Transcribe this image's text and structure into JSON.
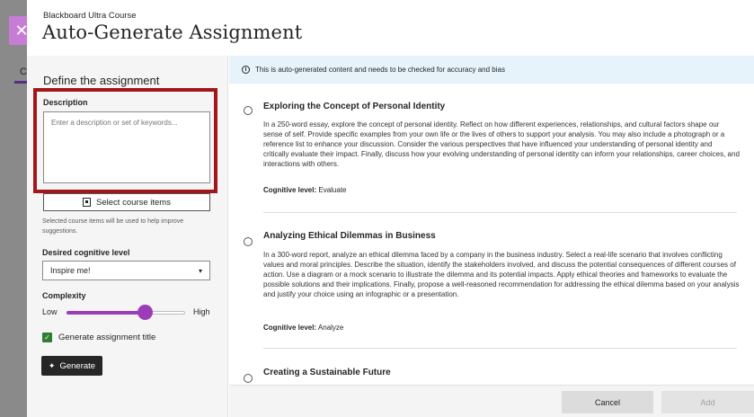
{
  "header": {
    "course_name": "Blackboard Ultra Course",
    "page_title": "Auto-Generate Assignment",
    "close_icon": "close-icon",
    "background_tab_letter": "C"
  },
  "left_panel": {
    "title": "Define the assignment",
    "description_label": "Description",
    "description_placeholder": "Enter a description or set of keywords...",
    "description_value": "",
    "select_items_label": "Select course items",
    "helper_text": "Selected course items will be used to help improve suggestions.",
    "cognitive_label": "Desired cognitive level",
    "cognitive_value": "Inspire me!",
    "complexity_label": "Complexity",
    "complexity_low": "Low",
    "complexity_high": "High",
    "complexity_value": 0.66,
    "generate_title_label": "Generate assignment title",
    "generate_title_checked": true,
    "generate_label": "Generate"
  },
  "notice": {
    "icon": "info-icon",
    "text": "This is auto-generated content and needs to be checked for accuracy and bias"
  },
  "options": [
    {
      "title": "Exploring the Concept of Personal Identity",
      "body": "In a 250-word essay, explore the concept of personal identity. Reflect on how different experiences, relationships, and cultural factors shape our sense of self. Provide specific examples from your own life or the lives of others to support your analysis. You may also include a photograph or a reference list to enhance your discussion. Consider the various perspectives that have influenced your understanding of personal identity and critically evaluate their impact. Finally, discuss how your evolving understanding of personal identity can inform your relationships, career choices, and interactions with others.",
      "level_label": "Cognitive level:",
      "level_value": "Evaluate"
    },
    {
      "title": "Analyzing Ethical Dilemmas in Business",
      "body": "In a 300-word report, analyze an ethical dilemma faced by a company in the business industry. Select a real-life scenario that involves conflicting values and moral principles. Describe the situation, identify the stakeholders involved, and discuss the potential consequences of different courses of action. Use a diagram or a mock scenario to illustrate the dilemma and its potential impacts. Apply ethical theories and frameworks to evaluate the possible solutions and their implications. Finally, propose a well-reasoned recommendation for addressing the ethical dilemma based on your analysis and justify your choice using an infographic or a presentation.",
      "level_label": "Cognitive level:",
      "level_value": "Analyze"
    },
    {
      "title": "Creating a Sustainable Future"
    }
  ],
  "footer": {
    "cancel_label": "Cancel",
    "add_label": "Add"
  },
  "colors": {
    "accent": "#9b3db6",
    "highlight_border": "#a3161a",
    "checkbox": "#2f7d32",
    "notice_bg": "#e6f3fb"
  }
}
